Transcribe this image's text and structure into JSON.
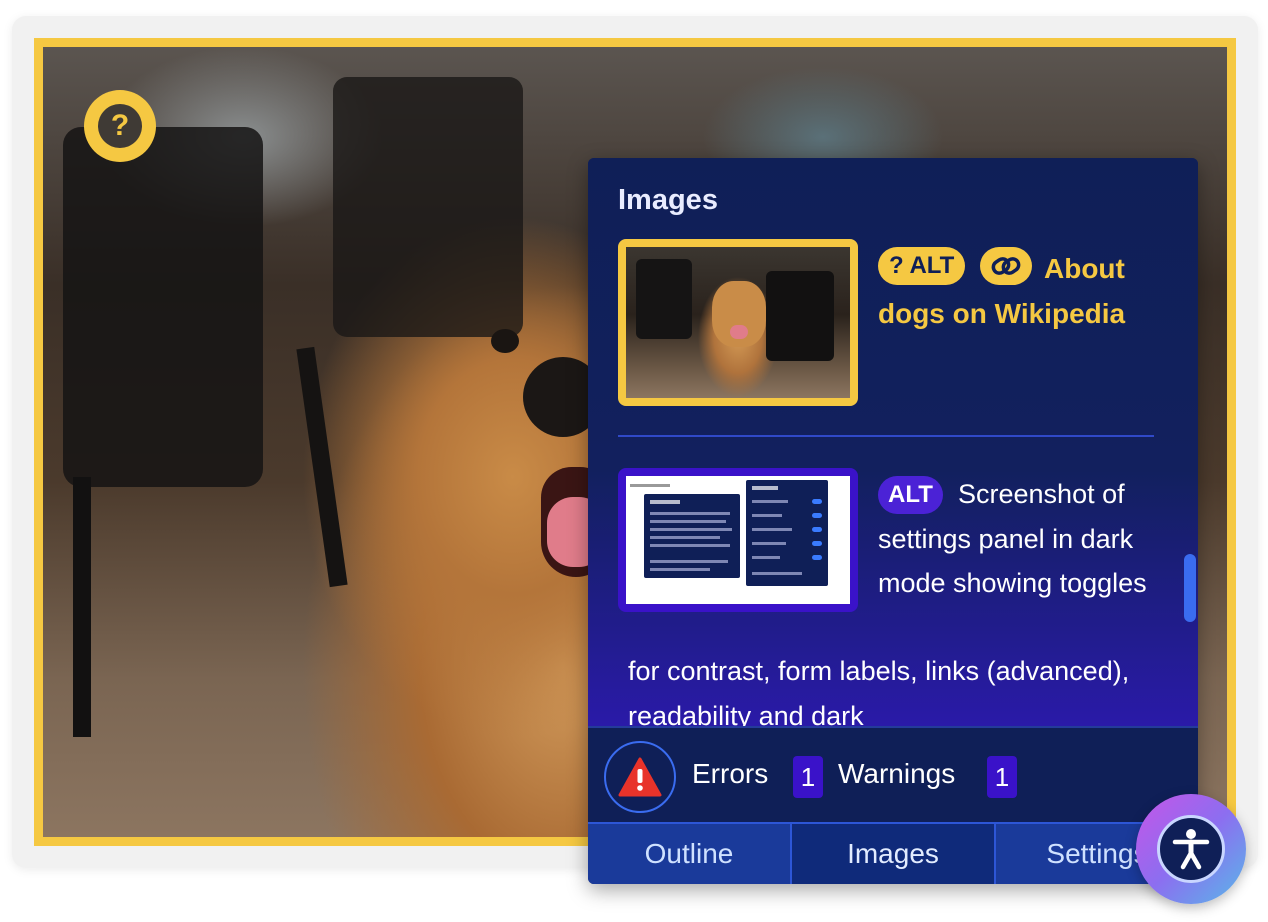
{
  "panel": {
    "title": "Images",
    "images": [
      {
        "badge_alt": "? ALT",
        "link_icon": "link-icon",
        "text": "About dogs on Wikipedia"
      },
      {
        "badge_alt": "ALT",
        "text_a": "Screenshot of settings panel in dark mode showing toggles",
        "text_b": "for contrast, form labels, links (advanced), readability and dark"
      }
    ]
  },
  "status": {
    "errors_label": "Errors",
    "errors_count": "1",
    "warnings_label": "Warnings",
    "warnings_count": "1"
  },
  "tabs": [
    {
      "label": "Outline"
    },
    {
      "label": "Images"
    },
    {
      "label": "Settings"
    }
  ],
  "colors": {
    "accent_yellow": "#f5c842",
    "panel_bg": "#0f1f57",
    "alt_badge_purple": "#4b22d6"
  }
}
